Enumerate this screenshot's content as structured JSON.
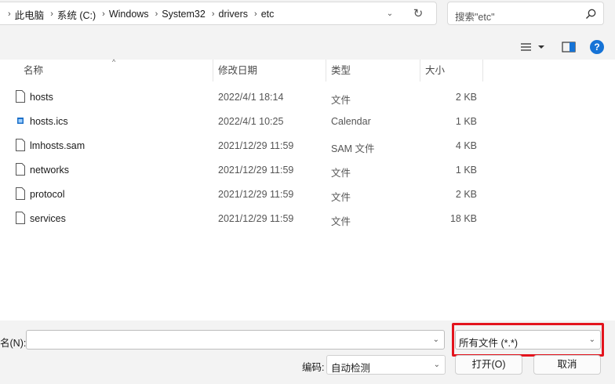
{
  "address": {
    "crumbs": [
      "此电脑",
      "系统 (C:)",
      "Windows",
      "System32",
      "drivers",
      "etc"
    ],
    "dropdown_icon": "chevron-down-icon",
    "refresh_icon": "refresh-icon"
  },
  "search": {
    "placeholder": "搜索\"etc\"",
    "icon": "search-icon"
  },
  "toolbar": {
    "view_icon": "list-view-icon",
    "preview_icon": "preview-pane-icon",
    "help_label": "?"
  },
  "columns": {
    "name": "名称",
    "date": "修改日期",
    "type": "类型",
    "size": "大小"
  },
  "files": [
    {
      "name": "hosts",
      "date": "2022/4/1 18:14",
      "type": "文件",
      "size": "2 KB",
      "icon": "file-icon"
    },
    {
      "name": "hosts.ics",
      "date": "2022/4/1 10:25",
      "type": "Calendar",
      "size": "1 KB",
      "icon": "calendar-file-icon"
    },
    {
      "name": "lmhosts.sam",
      "date": "2021/12/29 11:59",
      "type": "SAM 文件",
      "size": "4 KB",
      "icon": "file-icon"
    },
    {
      "name": "networks",
      "date": "2021/12/29 11:59",
      "type": "文件",
      "size": "1 KB",
      "icon": "file-icon"
    },
    {
      "name": "protocol",
      "date": "2021/12/29 11:59",
      "type": "文件",
      "size": "2 KB",
      "icon": "file-icon"
    },
    {
      "name": "services",
      "date": "2021/12/29 11:59",
      "type": "文件",
      "size": "18 KB",
      "icon": "file-icon"
    }
  ],
  "bottom": {
    "filename_label": "名(N):",
    "filename_value": "",
    "filter_value": "所有文件 (*.*)",
    "encoding_label": "编码:",
    "encoding_value": "自动检测",
    "open_label": "打开(O)",
    "cancel_label": "取消"
  },
  "colors": {
    "highlight": "#e3141d",
    "help": "#1673d6",
    "folder": "#e8b53f"
  }
}
